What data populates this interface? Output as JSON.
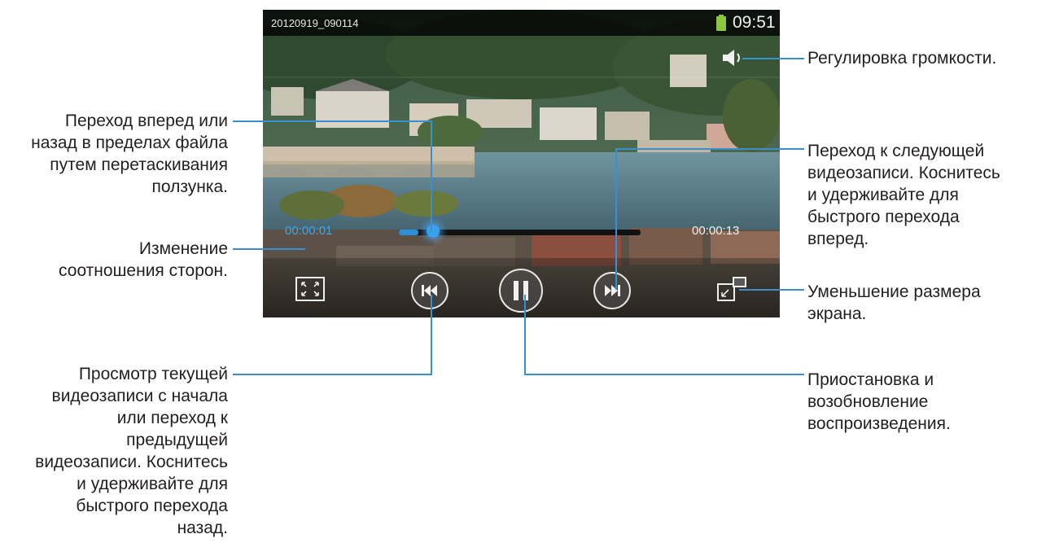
{
  "player": {
    "filename": "20120919_090114",
    "clock": "09:51",
    "current_time": "00:00:01",
    "total_time": "00:00:13",
    "progress": 0.08
  },
  "controls": {
    "aspect_icon": "aspect-ratio-icon",
    "prev_icon": "skip-previous-icon",
    "pause_icon": "pause-icon",
    "next_icon": "skip-next-icon",
    "mini_icon": "pop-up-player-icon",
    "volume_icon": "volume-icon",
    "battery_icon": "battery-icon"
  },
  "callouts": {
    "seek": [
      "Переход вперед или",
      "назад в пределах файла",
      "путем перетаскивания",
      "ползунка."
    ],
    "aspect": [
      "Изменение",
      "соотношения сторон."
    ],
    "prev": [
      "Просмотр текущей",
      "видеозаписи с начала",
      "или переход к",
      "предыдущей",
      "видеозаписи. Коснитесь",
      "и удерживайте для",
      "быстрого перехода",
      "назад."
    ],
    "volume": [
      "Регулировка громкости."
    ],
    "next": [
      "Переход к следующей",
      "видеозаписи. Коснитесь",
      "и удерживайте для",
      "быстрого перехода",
      "вперед."
    ],
    "mini": [
      "Уменьшение размера",
      "экрана."
    ],
    "pause": [
      "Приостановка и",
      "возобновление",
      "воспроизведения."
    ]
  },
  "colors": {
    "accent": "#2a8fd8",
    "callout_line": "#3a8fcf",
    "battery": "#8cc63f"
  }
}
